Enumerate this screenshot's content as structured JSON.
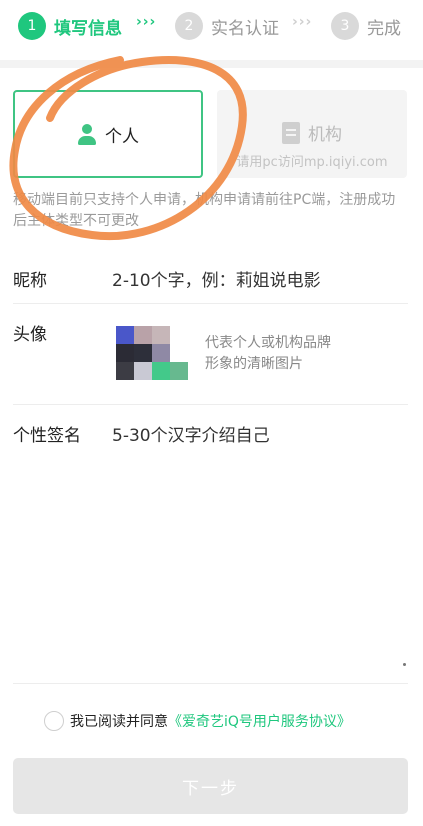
{
  "stepper": {
    "steps": [
      {
        "num": "1",
        "label": "填写信息"
      },
      {
        "num": "2",
        "label": "实名认证"
      },
      {
        "num": "3",
        "label": "完成"
      }
    ],
    "separator": "›››"
  },
  "account_types": {
    "personal": {
      "label": "个人"
    },
    "organization": {
      "label": "机构",
      "note": "请用pc访问mp.iqiyi.com"
    }
  },
  "notice": "移动端目前只支持个人申请，机构申请请前往PC端，注册成功后主体类型不可更改",
  "form": {
    "nickname": {
      "label": "昵称",
      "placeholder": "2-10个字，例：莉姐说电影"
    },
    "avatar": {
      "label": "头像",
      "hint_line1": "代表个人或机构品牌",
      "hint_line2": "形象的清晰图片"
    },
    "signature": {
      "label": "个性签名",
      "placeholder": "5-30个汉字介绍自己"
    }
  },
  "agreement": {
    "text": "我已阅读并同意",
    "link": "《爱奇艺iQ号用户服务协议》"
  },
  "next_button": "下一步",
  "colors": {
    "accent": "#1fc77e",
    "scribble": "#f08a45"
  }
}
